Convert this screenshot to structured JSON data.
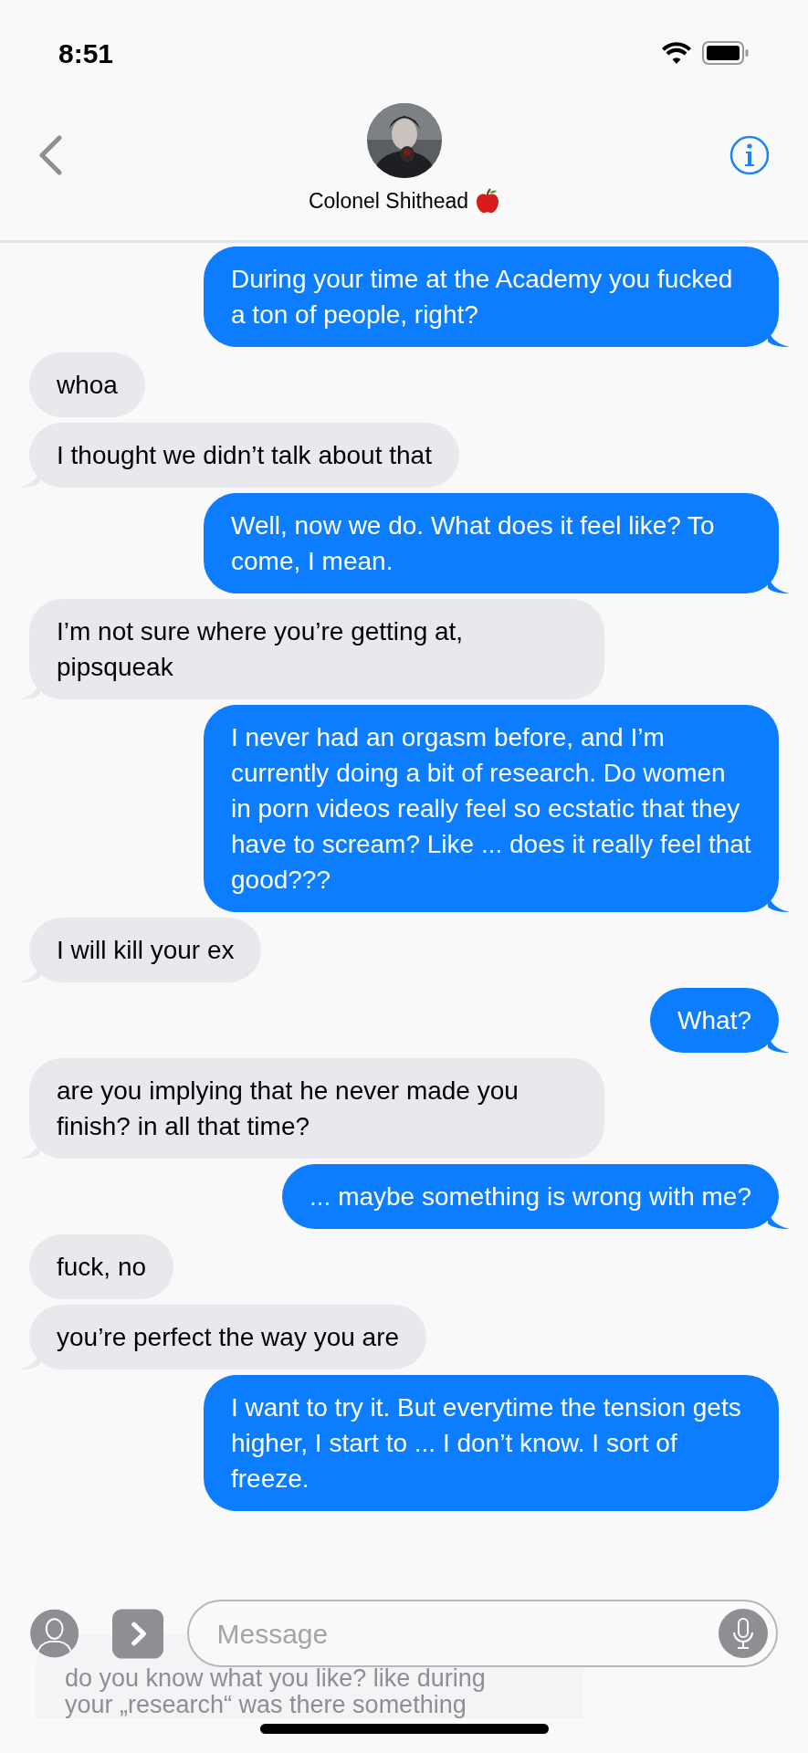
{
  "status_bar": {
    "time": "8:51"
  },
  "header": {
    "contact_name": "Colonel Shithead"
  },
  "messages": [
    {
      "kind": "sent",
      "text": "During your time at the Academy you fucked a ton of people, right?",
      "tail": true
    },
    {
      "kind": "received",
      "text": "whoa",
      "tail": false
    },
    {
      "kind": "received",
      "text": "I thought we didn’t talk about that",
      "tail": true
    },
    {
      "kind": "sent",
      "text": "Well, now we do. What does it feel like? To come, I mean.",
      "tail": true
    },
    {
      "kind": "received",
      "text": "I’m not sure where you’re getting at, pipsqueak",
      "tail": true
    },
    {
      "kind": "sent",
      "text": "I never had an orgasm before, and I’m currently doing a bit of research. Do women in porn videos really feel so ecstatic that they have to scream? Like ... does it really feel that good???",
      "tail": true
    },
    {
      "kind": "received",
      "text": "I will kill your ex",
      "tail": true
    },
    {
      "kind": "sent",
      "text": "What?",
      "tail": true
    },
    {
      "kind": "received",
      "text": "are you implying that he never made you finish? in all that time?",
      "tail": true
    },
    {
      "kind": "sent",
      "text": "... maybe something is wrong with me?",
      "tail": true
    },
    {
      "kind": "received",
      "text": "fuck, no",
      "tail": false
    },
    {
      "kind": "received",
      "text": "you’re perfect the way you are",
      "tail": true
    },
    {
      "kind": "sent",
      "text": "I want to try it. But everytime the tension gets higher, I start to ... I don’t know. I sort of freeze.",
      "tail": false
    }
  ],
  "faded_message": {
    "lines": [
      "do you know what you like? like during",
      "your „research“ was there something"
    ]
  },
  "composer": {
    "placeholder": "Message"
  }
}
